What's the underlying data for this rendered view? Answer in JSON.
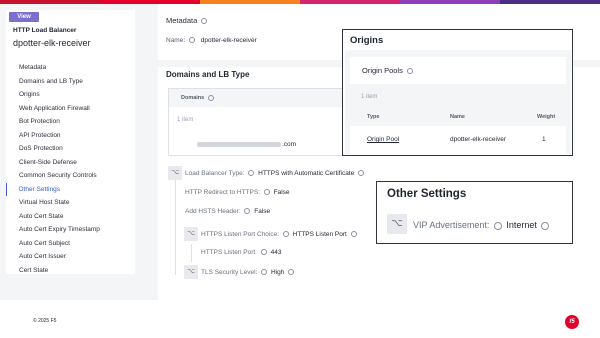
{
  "colors": {
    "accent": "#3b5bdb",
    "view_button": "#7b6fd0",
    "brand_red": "#e4002b",
    "topbar": [
      "#c8102e",
      "#e4002b",
      "#f5821f",
      "#d6246e",
      "#8e3fb7",
      "#4b2e83"
    ]
  },
  "sidebar": {
    "view_button": "View",
    "type_label": "HTTP Load Balancer",
    "name": "dpotter-elk-receiver",
    "items": [
      {
        "label": "Metadata"
      },
      {
        "label": "Domains and LB Type"
      },
      {
        "label": "Origins"
      },
      {
        "label": "Web Application Firewall"
      },
      {
        "label": "Bot Protection"
      },
      {
        "label": "API Protection"
      },
      {
        "label": "DoS Protection"
      },
      {
        "label": "Client-Side Defense"
      },
      {
        "label": "Common Security Controls"
      },
      {
        "label": "Other Settings",
        "active": true
      },
      {
        "label": "Virtual Host State"
      },
      {
        "label": "Auto Cert State"
      },
      {
        "label": "Auto Cert Expiry Timestamp"
      },
      {
        "label": "Auto Cert Subject"
      },
      {
        "label": "Auto Cert Issuer"
      },
      {
        "label": "Cert State"
      }
    ]
  },
  "metadata": {
    "title": "Metadata",
    "name_label": "Name:",
    "name_value": "dpotter-elk-receiver"
  },
  "domains": {
    "title": "Domains and LB Type",
    "table_header": "Domains",
    "count": "1 item",
    "value_suffix": ".com"
  },
  "lb_tree": {
    "lb_type_label": "Load Balancer Type:",
    "lb_type_value": "HTTPS with Automatic Certificate",
    "redirect_label": "HTTP Redirect to HTTPS:",
    "redirect_value": "False",
    "hsts_label": "Add HSTS Header:",
    "hsts_value": "False",
    "port_choice_label": "HTTPS Listen Port Choice:",
    "port_choice_value": "HTTPS Listen Port",
    "port_label": "HTTPS Listen Port:",
    "port_value": "443",
    "tls_label": "TLS Security Level:",
    "tls_value": "High"
  },
  "origins_popup": {
    "title": "Origins",
    "pools_title": "Origin Pools",
    "count": "1 item",
    "columns": [
      "Type",
      "Name",
      "Weight"
    ],
    "row": {
      "type": "Origin Pool",
      "name": "dpotter-elk-receiver",
      "weight": "1"
    }
  },
  "other_settings_popup": {
    "title": "Other Settings",
    "vip_label": "VIP Advertisement:",
    "vip_value": "Internet"
  },
  "footer": {
    "copyright": "© 2025 F5",
    "logo_text": "f5"
  }
}
